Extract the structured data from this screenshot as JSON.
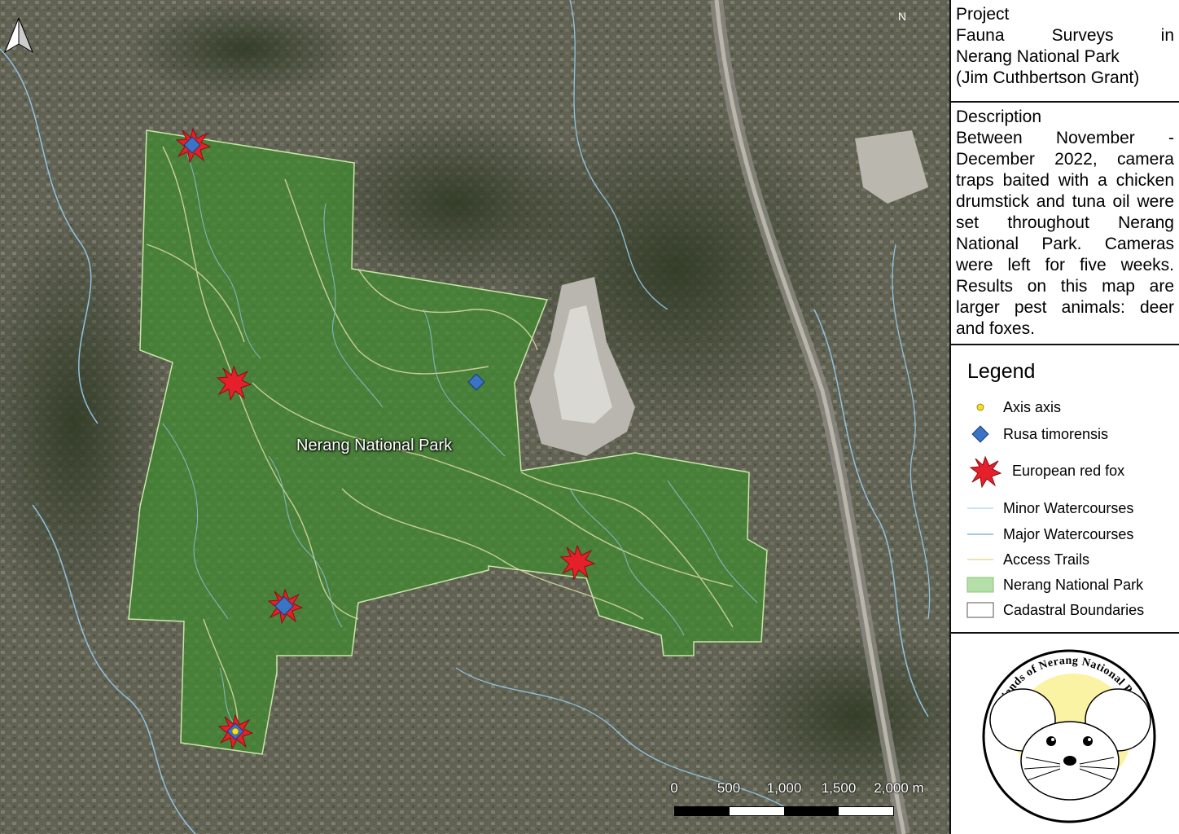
{
  "map": {
    "park_label": "Nerang National Park",
    "north_label": "N",
    "scale_ticks": [
      "0",
      "500",
      "1,000",
      "1,500",
      "2,000 m"
    ],
    "colors": {
      "park_fill": "#3f8c2f",
      "watercourse": "#8fc3e0",
      "trail": "#d8d7a0",
      "fox_marker": "#e5202a",
      "deer_marker": "#3b73c5",
      "axis_marker": "#f5e020"
    }
  },
  "panel": {
    "project": {
      "heading": "Project",
      "lines": [
        "Fauna Surveys in",
        "Nerang National Park",
        "(Jim Cuthbertson Grant)"
      ]
    },
    "description": {
      "heading": "Description",
      "text": "Between November - December 2022, camera traps baited with a chicken drumstick and tuna oil were set throughout Nerang National Park. Cameras were left for five weeks. Results on this map are larger pest animals: deer and foxes."
    },
    "legend": {
      "title": "Legend",
      "items": [
        {
          "label": "Axis axis",
          "icon": "yellow-dot-icon"
        },
        {
          "label": "Rusa timorensis",
          "icon": "blue-diamond-icon"
        },
        {
          "label": "European red fox",
          "icon": "red-star-icon"
        },
        {
          "label": "Minor Watercourses",
          "icon": "thin-blue-line-icon"
        },
        {
          "label": "Major Watercourses",
          "icon": "blue-line-icon"
        },
        {
          "label": "Access Trails",
          "icon": "yellow-line-icon"
        },
        {
          "label": "Nerang National Park",
          "icon": "green-fill-icon"
        },
        {
          "label": "Cadastral Boundaries",
          "icon": "outline-box-icon"
        }
      ]
    },
    "logo": {
      "text": "Friends of Nerang National Park",
      "icon": "mouse-logo-icon"
    }
  }
}
